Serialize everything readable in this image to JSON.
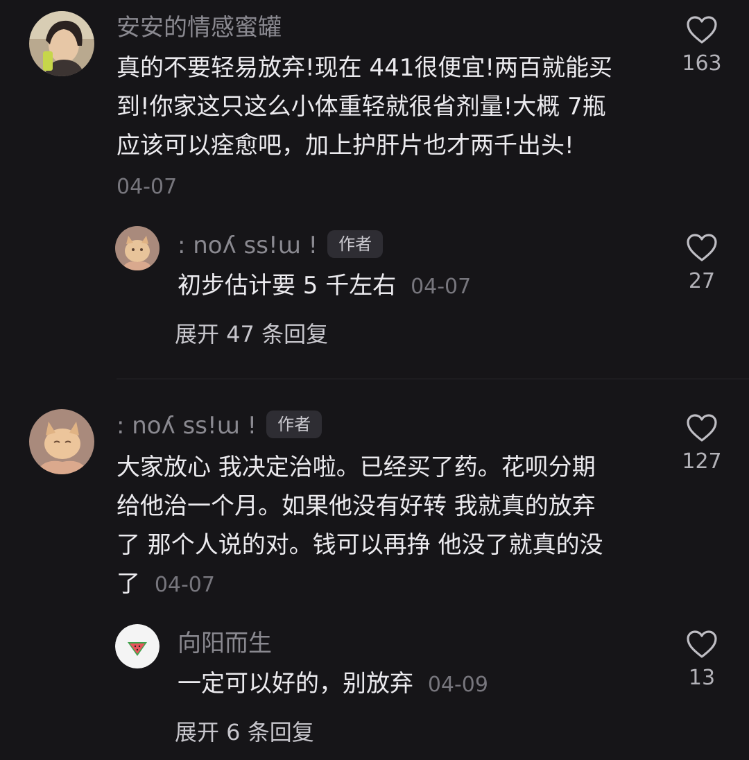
{
  "comments": [
    {
      "username": "安安的情感蜜罐",
      "lines": [
        "真的不要轻易放弃!现在 441很便宜!两百就能买",
        "到!你家这只这么小体重轻就很省剂量!大概 7瓶",
        "应该可以痊愈吧，加上护肝片也才两千出头!"
      ],
      "date": "04-07",
      "likes": "163",
      "reply": {
        "username": ": noʎ ss!ɯ !",
        "badge": "作者",
        "text": "初步估计要 5 千左右",
        "date": "04-07",
        "likes": "27"
      },
      "expand": "展开 47 条回复"
    },
    {
      "username": ": noʎ ss!ɯ !",
      "badge": "作者",
      "lines": [
        "大家放心 我决定治啦。已经买了药。花呗分期",
        "给他治一个月。如果他没有好转 我就真的放弃",
        "了 那个人说的对。钱可以再挣 他没了就真的没"
      ],
      "last_line": "了",
      "date": "04-07",
      "likes": "127",
      "reply": {
        "username": "向阳而生",
        "text": "一定可以好的，别放弃",
        "date": "04-09",
        "likes": "13"
      },
      "expand": "展开 6 条回复"
    }
  ]
}
